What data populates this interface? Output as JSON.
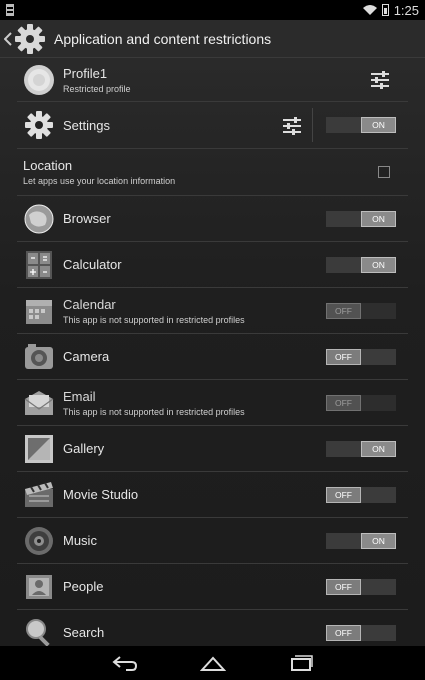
{
  "status": {
    "time": "1:25"
  },
  "actionbar": {
    "title": "Application and content restrictions"
  },
  "profile": {
    "name": "Profile1",
    "subtitle": "Restricted profile"
  },
  "settings": {
    "label": "Settings",
    "toggle": "ON"
  },
  "location": {
    "title": "Location",
    "subtitle": "Let apps use your location information"
  },
  "apps": [
    {
      "name": "Browser",
      "subtitle": "",
      "toggle": "ON",
      "enabled": true,
      "icon": "browser-icon"
    },
    {
      "name": "Calculator",
      "subtitle": "",
      "toggle": "ON",
      "enabled": true,
      "icon": "calculator-icon"
    },
    {
      "name": "Calendar",
      "subtitle": "This app is not supported in restricted profiles",
      "toggle": "OFF",
      "enabled": false,
      "icon": "calendar-icon"
    },
    {
      "name": "Camera",
      "subtitle": "",
      "toggle": "OFF",
      "enabled": true,
      "icon": "camera-icon"
    },
    {
      "name": "Email",
      "subtitle": "This app is not supported in restricted profiles",
      "toggle": "OFF",
      "enabled": false,
      "icon": "email-icon"
    },
    {
      "name": "Gallery",
      "subtitle": "",
      "toggle": "ON",
      "enabled": true,
      "icon": "gallery-icon"
    },
    {
      "name": "Movie Studio",
      "subtitle": "",
      "toggle": "OFF",
      "enabled": true,
      "icon": "movie-studio-icon"
    },
    {
      "name": "Music",
      "subtitle": "",
      "toggle": "ON",
      "enabled": true,
      "icon": "music-icon"
    },
    {
      "name": "People",
      "subtitle": "",
      "toggle": "OFF",
      "enabled": true,
      "icon": "people-icon"
    },
    {
      "name": "Search",
      "subtitle": "",
      "toggle": "OFF",
      "enabled": true,
      "icon": "search-icon"
    }
  ]
}
